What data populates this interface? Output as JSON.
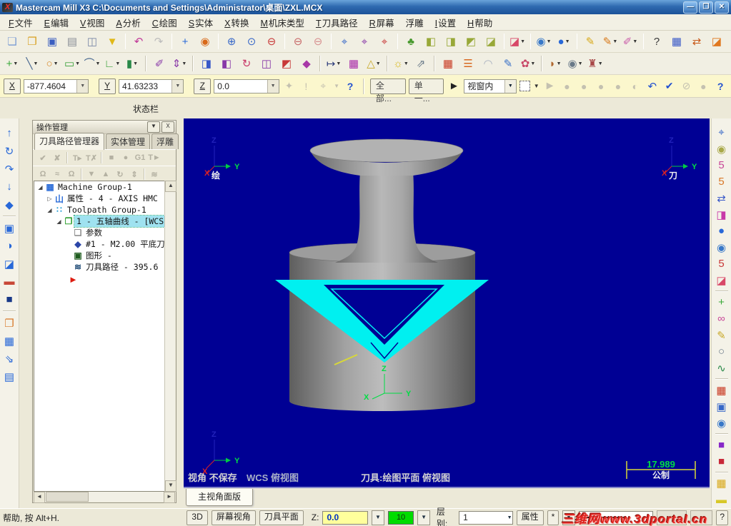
{
  "window": {
    "logo": "X",
    "title": "Mastercam Mill X3  C:\\Documents and Settings\\Administrator\\桌面\\ZXL.MCX",
    "controls": {
      "minimize": "—",
      "maximize": "❐",
      "close": "✕"
    }
  },
  "menu": {
    "items": [
      {
        "key": "F",
        "label": "文件"
      },
      {
        "key": "E",
        "label": "编辑"
      },
      {
        "key": "V",
        "label": "视图"
      },
      {
        "key": "A",
        "label": "分析"
      },
      {
        "key": "C",
        "label": "绘图"
      },
      {
        "key": "S",
        "label": "实体"
      },
      {
        "key": "X",
        "label": "转换"
      },
      {
        "key": "M",
        "label": "机床类型"
      },
      {
        "key": "T",
        "label": "刀具路径"
      },
      {
        "key": "R",
        "label": "屏幕"
      },
      {
        "key": "",
        "label": "浮雕"
      },
      {
        "key": "I",
        "label": "设置"
      },
      {
        "key": "H",
        "label": "帮助"
      }
    ]
  },
  "toolbar_row1": [
    {
      "n": "new-file",
      "g": "❏",
      "c": "#7a9cd4"
    },
    {
      "n": "open-file",
      "g": "❐",
      "c": "#d8a020"
    },
    {
      "n": "save-file",
      "g": "▣",
      "c": "#3a5ec0"
    },
    {
      "n": "print",
      "g": "▤",
      "c": "#8a8f98"
    },
    {
      "n": "print-preview",
      "g": "◫",
      "c": "#7a88a8"
    },
    {
      "n": "delete-entity",
      "g": "▼",
      "c": "#e0b818"
    },
    {
      "sep": true
    },
    {
      "n": "undo",
      "g": "↶",
      "c": "#c03898"
    },
    {
      "n": "redo",
      "g": "↷",
      "c": "#bcbcbc"
    },
    {
      "sep": true
    },
    {
      "n": "pan",
      "g": "+",
      "c": "#2868d8"
    },
    {
      "n": "dynamic-rotate",
      "g": "◉",
      "c": "#d86818"
    },
    {
      "sep": true
    },
    {
      "n": "zoom-in",
      "g": "⊕",
      "c": "#3868c8"
    },
    {
      "n": "zoom-window",
      "g": "⊙",
      "c": "#3868c8"
    },
    {
      "n": "zoom-out",
      "g": "⊖",
      "c": "#c83838"
    },
    {
      "sep": true
    },
    {
      "n": "zoom-target",
      "g": "⊖",
      "c": "#c86868"
    },
    {
      "n": "zoom-previous",
      "g": "⊖",
      "c": "#d89090"
    },
    {
      "sep": true
    },
    {
      "n": "fit-screen",
      "g": "⌖",
      "c": "#3868c8"
    },
    {
      "n": "repaint",
      "g": "⌖",
      "c": "#8838a8"
    },
    {
      "n": "regenerate",
      "g": "⌖",
      "c": "#c83838"
    },
    {
      "sep": true
    },
    {
      "n": "gview-tree",
      "g": "♣",
      "c": "#4a9a30"
    },
    {
      "n": "gview-top",
      "g": "◧",
      "c": "#98a838"
    },
    {
      "n": "gview-front",
      "g": "◨",
      "c": "#98a838"
    },
    {
      "n": "gview-side",
      "g": "◩",
      "c": "#98a838"
    },
    {
      "n": "gview-iso",
      "g": "◪",
      "c": "#98a838"
    },
    {
      "sep": true
    },
    {
      "n": "shading-mode",
      "g": "◪",
      "c": "#d84868",
      "dd": 1
    },
    {
      "sep": true
    },
    {
      "n": "render-globe",
      "g": "◉",
      "c": "#3878c8",
      "dd": 1
    },
    {
      "n": "shade-sphere",
      "g": "●",
      "c": "#2868d8",
      "dd": 1
    },
    {
      "sep": true
    },
    {
      "n": "analyze-pencil",
      "g": "✎",
      "c": "#d8a818"
    },
    {
      "n": "analyze-multi-pencil",
      "g": "✎",
      "c": "#d87818",
      "dd": 1
    },
    {
      "n": "analyze-eraser",
      "g": "✐",
      "c": "#c858a8",
      "dd": 1
    },
    {
      "sep": true
    },
    {
      "n": "help-pointer",
      "g": "?",
      "c": "#383838"
    },
    {
      "n": "levels-manager",
      "g": "▦",
      "c": "#3858c8"
    },
    {
      "n": "swap-levels",
      "g": "⇄",
      "c": "#c85818"
    },
    {
      "n": "material-box",
      "g": "◪",
      "c": "#e07820"
    },
    {
      "n": "summary-sigma",
      "g": "Σ",
      "c": "#2868c8"
    },
    {
      "n": "export-data",
      "g": "►",
      "c": "#38a038",
      "dd": 1
    }
  ],
  "toolbar_row2": [
    {
      "n": "create-point",
      "g": "+",
      "c": "#38a838",
      "dd": 1
    },
    {
      "n": "create-line",
      "g": "╲",
      "c": "#486890",
      "dd": 1
    },
    {
      "n": "create-arc",
      "g": "○",
      "c": "#d88828",
      "dd": 1
    },
    {
      "n": "create-rectangle",
      "g": "▭",
      "c": "#38a038",
      "dd": 1
    },
    {
      "n": "create-fillet",
      "g": "⌒",
      "c": "#486890",
      "dd": 1
    },
    {
      "n": "create-polyline",
      "g": "∟",
      "c": "#38a038",
      "dd": 1
    },
    {
      "n": "create-primitive",
      "g": "▮",
      "c": "#288848",
      "dd": 1
    },
    {
      "sep": true
    },
    {
      "n": "measure-cursor",
      "g": "✐",
      "c": "#8838a8"
    },
    {
      "n": "measure-vertical",
      "g": "⇕",
      "c": "#8838a8",
      "dd": 1
    },
    {
      "sep": true
    },
    {
      "n": "xform-translate",
      "g": "◨",
      "c": "#3858c8"
    },
    {
      "n": "xform-mirror",
      "g": "◧",
      "c": "#8838a8"
    },
    {
      "n": "xform-rotate",
      "g": "↻",
      "c": "#c83868"
    },
    {
      "n": "xform-offset",
      "g": "◫",
      "c": "#8838a8"
    },
    {
      "n": "xform-scale",
      "g": "◩",
      "c": "#c83838"
    },
    {
      "n": "xform-wrap",
      "g": "◆",
      "c": "#a838a8"
    },
    {
      "sep": true
    },
    {
      "n": "fit-arrows",
      "g": "↦",
      "c": "#283878",
      "dd": 1
    },
    {
      "n": "pattern-grid",
      "g": "▦",
      "c": "#a828a8"
    },
    {
      "n": "warning-triangle",
      "g": "△",
      "c": "#c8a828",
      "dd": 1
    },
    {
      "sep": true
    },
    {
      "n": "light-bulb",
      "g": "☼",
      "c": "#d8b818",
      "dd": 1
    },
    {
      "n": "pointer-diagonal",
      "g": "⇗",
      "c": "#687888"
    },
    {
      "sep": true
    },
    {
      "n": "grid-window",
      "g": "▦",
      "c": "#c83820"
    },
    {
      "n": "align-lines",
      "g": "☰",
      "c": "#d86820"
    },
    {
      "n": "surface-dome",
      "g": "◠",
      "c": "#a8b0c0"
    },
    {
      "n": "surface-pencil",
      "g": "✎",
      "c": "#3870c8"
    },
    {
      "n": "surface-flower",
      "g": "✿",
      "c": "#c84868",
      "dd": 1
    },
    {
      "sep": true
    },
    {
      "n": "machine-sim",
      "g": "◗",
      "c": "#b06830",
      "dd": 1
    },
    {
      "n": "mesh-sphere",
      "g": "◉",
      "c": "#687888",
      "dd": 1
    },
    {
      "n": "post-tower",
      "g": "♜",
      "c": "#a84848",
      "dd": 1
    }
  ],
  "left_toolbar": [
    {
      "n": "solid-extrude",
      "g": "↑",
      "c": "#2868d8"
    },
    {
      "n": "solid-revolve",
      "g": "↻",
      "c": "#2868d8"
    },
    {
      "n": "solid-sweep",
      "g": "↷",
      "c": "#2868d8"
    },
    {
      "n": "solid-loft",
      "g": "↓",
      "c": "#2868d8"
    },
    {
      "n": "solid-fillet",
      "g": "◆",
      "c": "#2868d8"
    },
    {
      "sep": true
    },
    {
      "n": "solid-shell",
      "g": "▣",
      "c": "#2868d8"
    },
    {
      "n": "solid-boolean",
      "g": "◑",
      "c": "#2868d8"
    },
    {
      "n": "solid-trim",
      "g": "◪",
      "c": "#2868d8"
    },
    {
      "n": "solid-thicken",
      "g": "▬",
      "c": "#c84838"
    },
    {
      "n": "solid-block",
      "g": "■",
      "c": "#183888"
    },
    {
      "sep": true
    },
    {
      "n": "solid-draft",
      "g": "❐",
      "c": "#d87828"
    },
    {
      "n": "solid-split",
      "g": "▦",
      "c": "#2868d8"
    },
    {
      "n": "solid-project",
      "g": "⇘",
      "c": "#2868d8"
    },
    {
      "n": "solid-layout",
      "g": "▤",
      "c": "#2868d8"
    }
  ],
  "right_toolbar": [
    {
      "n": "analyze-binoculars",
      "g": "⌖",
      "c": "#3868c8"
    },
    {
      "n": "wireframe-sphere",
      "g": "◉",
      "c": "#a8a848"
    },
    {
      "n": "c5-pencil",
      "g": "5",
      "c": "#c84898"
    },
    {
      "n": "c5-brush",
      "g": "5",
      "c": "#d87828"
    },
    {
      "n": "hierarchy-swap",
      "g": "⇄",
      "c": "#3858c8"
    },
    {
      "n": "transform-squares",
      "g": "◨",
      "c": "#c838a8"
    },
    {
      "n": "shaded-sphere",
      "g": "●",
      "c": "#2868d8"
    },
    {
      "n": "render-globe",
      "g": "◉",
      "c": "#3878c8"
    },
    {
      "n": "c5-eraser",
      "g": "5",
      "c": "#c83838"
    },
    {
      "n": "shaded-cube",
      "g": "◪",
      "c": "#d84868"
    },
    {
      "sep": true
    },
    {
      "n": "add-entity",
      "g": "+",
      "c": "#38a838"
    },
    {
      "n": "goggles-mask",
      "g": "∞",
      "c": "#c84898"
    },
    {
      "n": "quick-pencil",
      "g": "✎",
      "c": "#c8a828"
    },
    {
      "n": "quick-circle",
      "g": "○",
      "c": "#687888"
    },
    {
      "n": "quick-spline",
      "g": "∿",
      "c": "#288848"
    },
    {
      "sep": true
    },
    {
      "n": "quick-grid",
      "g": "▦",
      "c": "#c83820"
    },
    {
      "n": "cube-pencil",
      "g": "▣",
      "c": "#3868c8"
    },
    {
      "n": "globe-pencil",
      "g": "◉",
      "c": "#3878c8"
    },
    {
      "sep": true
    },
    {
      "n": "attr-color-purple",
      "g": "■",
      "c": "#8828c8"
    },
    {
      "n": "attr-color-red",
      "g": "■",
      "c": "#c82838"
    },
    {
      "sep": true
    },
    {
      "n": "attr-palette",
      "g": "▦",
      "c": "#d8a818"
    },
    {
      "n": "attr-style",
      "g": "▬",
      "c": "#d8c828"
    }
  ],
  "coord_bar": {
    "x_label": "X",
    "x_value": "-877.4604",
    "y_label": "Y",
    "y_value": "41.63233",
    "z_label": "Z",
    "z_value": "0.0",
    "all_button": "全部...",
    "single_button": "单一...",
    "range_select": "视窗内",
    "help": "?"
  },
  "status_label": "状态栏",
  "operations_panel": {
    "title": "操作管理",
    "collapse_button": "▼",
    "close_button": "X",
    "tabs": [
      "刀具路径管理器",
      "实体管理",
      "浮雕"
    ],
    "tools_row1": [
      {
        "n": "select-all-operations",
        "g": "✔"
      },
      {
        "n": "unselect-all-operations",
        "g": "✘"
      },
      {
        "sep": true
      },
      {
        "n": "regen-selected",
        "g": "T▸"
      },
      {
        "n": "remove-selected",
        "g": "T✗"
      },
      {
        "sep": true
      },
      {
        "n": "backplot",
        "g": "■"
      },
      {
        "n": "verify",
        "g": "●"
      },
      {
        "n": "g1-edit",
        "g": "G1"
      },
      {
        "n": "post-process",
        "g": "T►"
      }
    ],
    "tools_row2": [
      {
        "n": "lock-operation",
        "g": "Ω"
      },
      {
        "n": "toggle-toolpath-display",
        "g": "≈"
      },
      {
        "n": "lock-display",
        "g": "Ω"
      },
      {
        "sep": true
      },
      {
        "n": "move-down",
        "g": "▼"
      },
      {
        "n": "move-up",
        "g": "▲"
      },
      {
        "n": "scroll-insert",
        "g": "↻"
      },
      {
        "n": "toggle-insert",
        "g": "⇕"
      },
      {
        "sep": true
      },
      {
        "n": "hide-toolpath",
        "g": "≋"
      }
    ],
    "tree": [
      {
        "label": "Machine Group-1",
        "level": 0,
        "exp": "open",
        "icon": "machine-group",
        "icon_glyph": "▦",
        "icon_color": "#2b6cd8"
      },
      {
        "label": "属性 - 4 - AXIS HMC",
        "level": 1,
        "exp": "closed",
        "icon": "properties",
        "icon_glyph": "山",
        "icon_color": "#2b6cd8"
      },
      {
        "label": "Toolpath Group-1",
        "level": 1,
        "exp": "open",
        "icon": "toolpath-group",
        "icon_glyph": "∷",
        "icon_color": "#2ba0d8"
      },
      {
        "label": "1 - 五轴曲线 - [WCS",
        "level": 2,
        "exp": "open",
        "icon": "operation-folder",
        "icon_glyph": "❐",
        "icon_color": "#2f9e2f",
        "selected": true
      },
      {
        "label": "参数",
        "level": 3,
        "exp": "",
        "icon": "parameters",
        "icon_glyph": "❏",
        "icon_color": "#8f8f8f"
      },
      {
        "label": "#1 - M2.00 平底刀",
        "level": 3,
        "exp": "",
        "icon": "tool",
        "icon_glyph": "◆",
        "icon_color": "#2b46a8"
      },
      {
        "label": "图形 -",
        "level": 3,
        "exp": "",
        "icon": "geometry",
        "icon_glyph": "▣",
        "icon_color": "#1e5c1e"
      },
      {
        "label": "刀具路径 - 395.6",
        "level": 3,
        "exp": "",
        "icon": "toolpath",
        "icon_glyph": "≋",
        "icon_color": "#12406e"
      }
    ],
    "insert_marker": "►"
  },
  "viewport": {
    "status_angle": "视角 不保存",
    "status_wcs": "WCS 俯视图",
    "status_tool": "刀具:绘图平面 俯视图",
    "scale_value": "17.989",
    "scale_unit": "公制",
    "gizmos": {
      "draw_label": "绘",
      "tool_label": "刀",
      "x": "X",
      "y": "Y",
      "z": "Z"
    },
    "colors": {
      "background": "#000094",
      "model_gray": "#9a9a9a",
      "band_cyan": "#00f0f0",
      "axis_green": "#00dd44",
      "axis_red": "#dd2222",
      "axis_blue": "#2222bb",
      "scale_yellow": "#d8d838"
    }
  },
  "view_tab": "主视角面版",
  "bottom_bar": {
    "help_text": "帮助, 按 Alt+H.",
    "mode_3d": "3D",
    "screen_view": "屏幕视角",
    "tool_plane": "刀具平面",
    "z_label": "Z:",
    "z_value": "0.0",
    "color_value": "10",
    "level_label": "层别:",
    "level_value": "1",
    "attributes_label": "属性",
    "star": "*",
    "help_q": "?"
  },
  "watermark": "三维网www.3dportal.cn"
}
